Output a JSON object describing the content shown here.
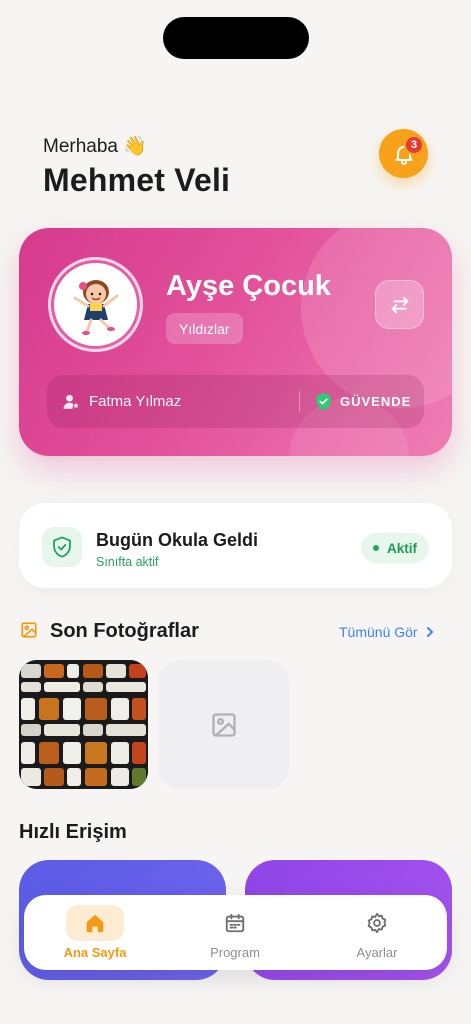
{
  "header": {
    "greeting": "Merhaba 👋",
    "parent_name": "Mehmet Veli",
    "notification_count": "3"
  },
  "child_card": {
    "child_name": "Ayşe Çocuk",
    "class_name": "Yıldızlar",
    "guardian_name": "Fatma Yılmaz",
    "safety_status": "GÜVENDE",
    "colors": {
      "gradient_start": "#d63a8e",
      "gradient_end": "#f07db4"
    }
  },
  "attendance": {
    "title": "Bugün Okula Geldi",
    "subtitle": "Sınıfta aktif",
    "badge": "Aktif",
    "status_color": "#22a45d"
  },
  "photos": {
    "title": "Son Fotoğraflar",
    "see_all": "Tümünü Gör"
  },
  "quick_access": {
    "title": "Hızlı Erişim"
  },
  "bottom_nav": {
    "items": [
      {
        "label": "Ana Sayfa",
        "icon": "home-icon",
        "active": true
      },
      {
        "label": "Program",
        "icon": "calendar-icon",
        "active": false
      },
      {
        "label": "Ayarlar",
        "icon": "gear-icon",
        "active": false
      }
    ],
    "accent": "#f39a12"
  }
}
